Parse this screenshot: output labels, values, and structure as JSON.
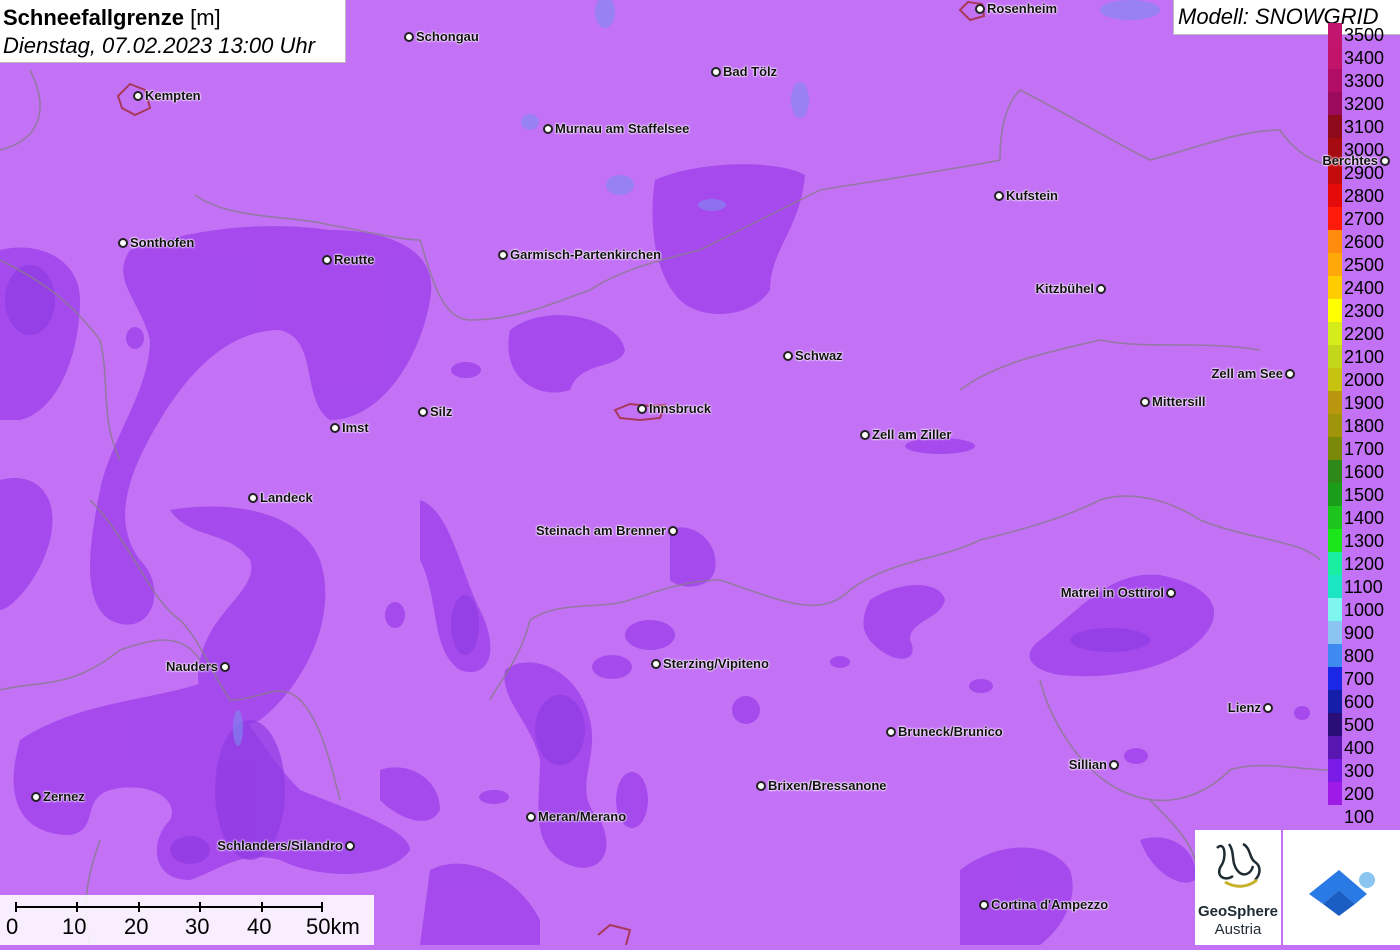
{
  "title": {
    "parameter": "Schneefallgrenze",
    "unit": "[m]",
    "datetime": "Dienstag, 07.02.2023 13:00 Uhr"
  },
  "model_label": "Modell: SNOWGRID",
  "legend": [
    {
      "value": "3500",
      "color": "#c2166e"
    },
    {
      "value": "3400",
      "color": "#c2146a"
    },
    {
      "value": "3300",
      "color": "#b10d66"
    },
    {
      "value": "3200",
      "color": "#9c0a5d"
    },
    {
      "value": "3100",
      "color": "#8c0a1a"
    },
    {
      "value": "3000",
      "color": "#a50b10"
    },
    {
      "value": "2900",
      "color": "#c40a0a"
    },
    {
      "value": "2800",
      "color": "#e60b0b"
    },
    {
      "value": "2700",
      "color": "#ff1a0a"
    },
    {
      "value": "2600",
      "color": "#ff8c0d"
    },
    {
      "value": "2500",
      "color": "#ffa80a"
    },
    {
      "value": "2400",
      "color": "#ffcc00"
    },
    {
      "value": "2300",
      "color": "#ffff00"
    },
    {
      "value": "2200",
      "color": "#d4ec1a"
    },
    {
      "value": "2100",
      "color": "#c2d61a"
    },
    {
      "value": "2000",
      "color": "#c7c20f"
    },
    {
      "value": "1900",
      "color": "#b8960d"
    },
    {
      "value": "1800",
      "color": "#a0940a"
    },
    {
      "value": "1700",
      "color": "#7a8a08"
    },
    {
      "value": "1600",
      "color": "#2e8a18"
    },
    {
      "value": "1500",
      "color": "#1a9e1a"
    },
    {
      "value": "1400",
      "color": "#1ec41e"
    },
    {
      "value": "1300",
      "color": "#1ae61a"
    },
    {
      "value": "1200",
      "color": "#1aeea0"
    },
    {
      "value": "1100",
      "color": "#1ae6c2"
    },
    {
      "value": "1000",
      "color": "#7ff5f0"
    },
    {
      "value": "900",
      "color": "#8ac4f0"
    },
    {
      "value": "800",
      "color": "#3e8af0"
    },
    {
      "value": "700",
      "color": "#1a28e6"
    },
    {
      "value": "600",
      "color": "#141ea8"
    },
    {
      "value": "500",
      "color": "#2a0e78"
    },
    {
      "value": "400",
      "color": "#5a16b0"
    },
    {
      "value": "300",
      "color": "#7a1ae6"
    },
    {
      "value": "200",
      "color": "#9e1ae6"
    },
    {
      "value": "100",
      "color": "#c372f5"
    }
  ],
  "cities": [
    {
      "name": "Rosenheim"
    },
    {
      "name": "Schongau"
    },
    {
      "name": "Bad Tölz"
    },
    {
      "name": "Kempten"
    },
    {
      "name": "Murnau am Staffelsee"
    },
    {
      "name": "Berchtes"
    },
    {
      "name": "Kufstein"
    },
    {
      "name": "Sonthofen"
    },
    {
      "name": "Reutte"
    },
    {
      "name": "Garmisch-Partenkirchen"
    },
    {
      "name": "Kitzbühel"
    },
    {
      "name": "Schwaz"
    },
    {
      "name": "Zell am See"
    },
    {
      "name": "Silz"
    },
    {
      "name": "Innsbruck"
    },
    {
      "name": "Mittersill"
    },
    {
      "name": "Imst"
    },
    {
      "name": "Zell am Ziller"
    },
    {
      "name": "Landeck"
    },
    {
      "name": "Steinach am Brenner"
    },
    {
      "name": "Matrei in Osttirol"
    },
    {
      "name": "Nauders"
    },
    {
      "name": "Sterzing/Vipiteno"
    },
    {
      "name": "Lienz"
    },
    {
      "name": "Bruneck/Brunico"
    },
    {
      "name": "Sillian"
    },
    {
      "name": "Zernez"
    },
    {
      "name": "Brixen/Bressanone"
    },
    {
      "name": "Meran/Merano"
    },
    {
      "name": "Schlanders/Silandro"
    },
    {
      "name": "Cortina d'Ampezzo"
    }
  ],
  "scale_bar": {
    "labels": [
      "0",
      "10",
      "20",
      "30",
      "40",
      "50km"
    ]
  },
  "logo": {
    "line1": "GeoSphere",
    "line2": "Austria"
  },
  "colors": {
    "background": "#c372f5",
    "band_200": "#9e3ef0",
    "band_300": "#8a2ee6"
  }
}
